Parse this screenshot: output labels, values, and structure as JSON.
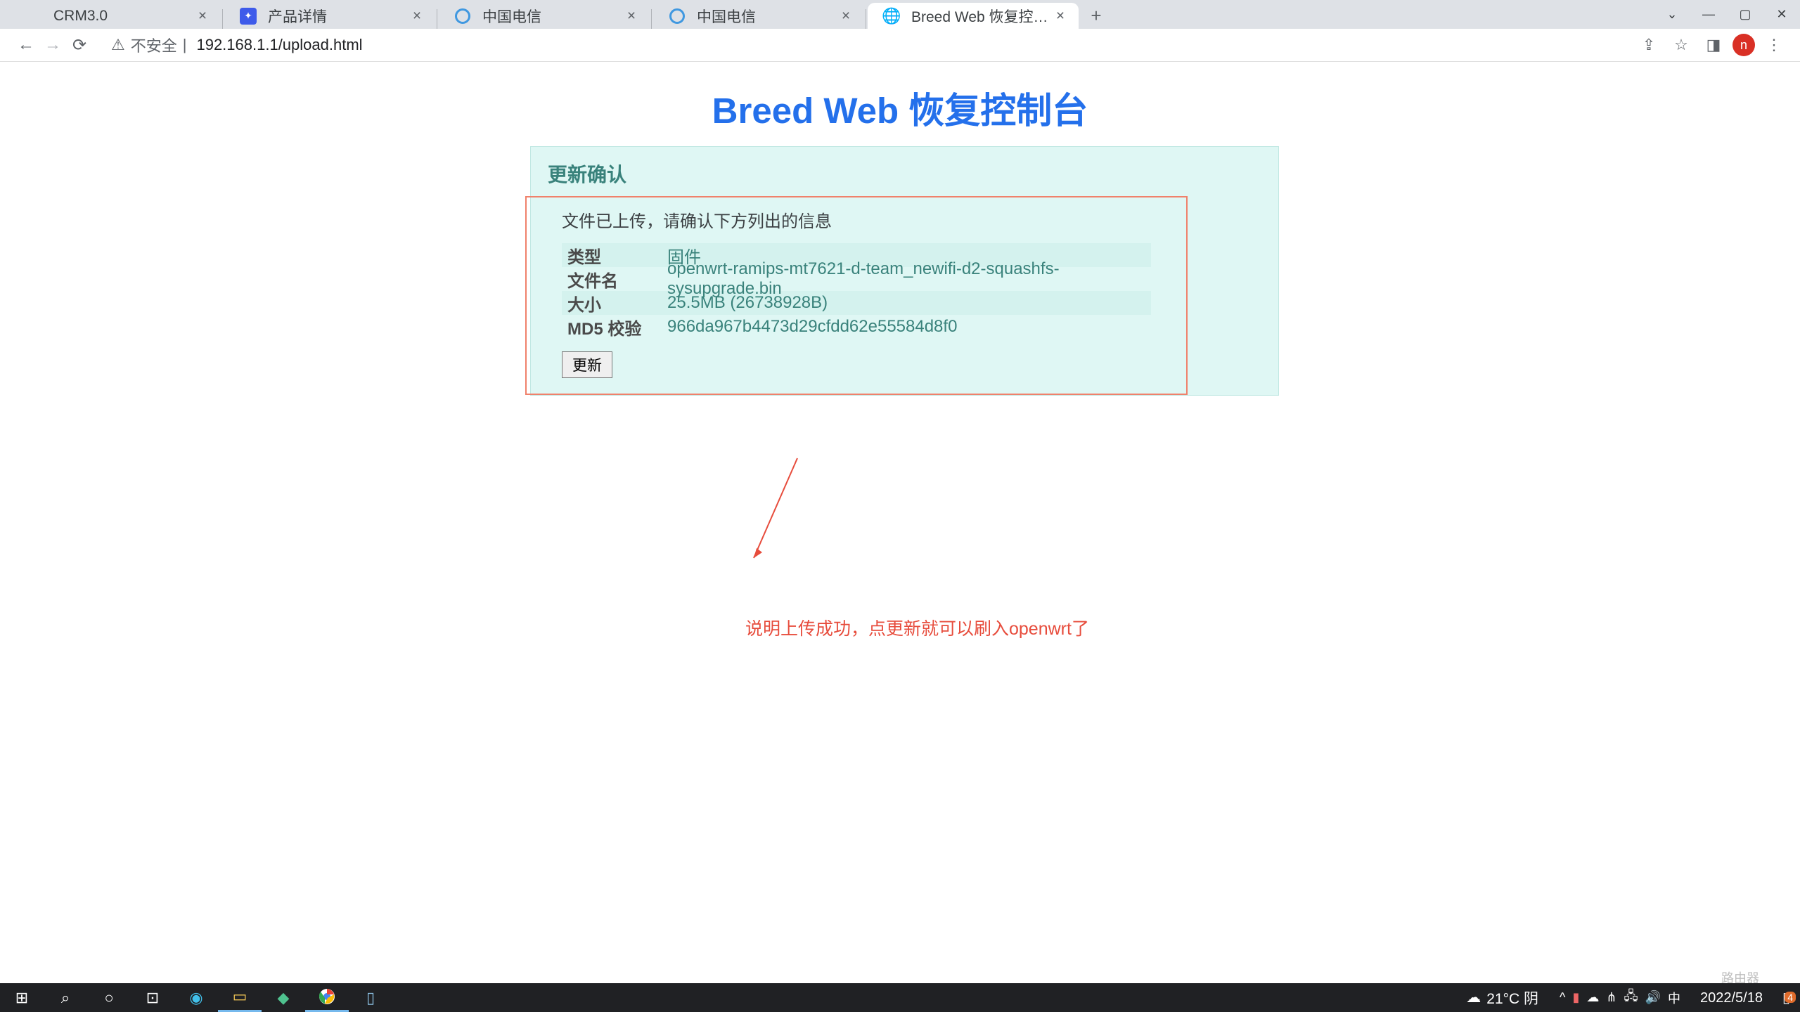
{
  "tabs": [
    {
      "title": "CRM3.0",
      "favicon_type": "blank"
    },
    {
      "title": "产品详情",
      "favicon_type": "blue"
    },
    {
      "title": "中国电信",
      "favicon_type": "circle"
    },
    {
      "title": "中国电信",
      "favicon_type": "circle"
    },
    {
      "title": "Breed Web 恢复控制台",
      "favicon_type": "globe",
      "active": true
    }
  ],
  "address": {
    "security_label": "不安全",
    "separator": "|",
    "url": "192.168.1.1/upload.html"
  },
  "profile_letter": "n",
  "page": {
    "title": "Breed Web 恢复控制台",
    "panel_header": "更新确认",
    "upload_message": "文件已上传，请确认下方列出的信息",
    "rows": [
      {
        "label": "类型",
        "value": "固件"
      },
      {
        "label": "文件名",
        "value": "openwrt-ramips-mt7621-d-team_newifi-d2-squashfs-sysupgrade.bin"
      },
      {
        "label": "大小",
        "value": "25.5MB (26738928B)"
      },
      {
        "label": "MD5 校验",
        "value": "966da967b4473d29cfdd62e55584d8f0"
      }
    ],
    "update_button": "更新",
    "annotation": "说明上传成功，点更新就可以刷入openwrt了"
  },
  "watermark": "路由器",
  "taskbar": {
    "weather": "21°C 阴",
    "ime": "中",
    "time": "2022/5/18",
    "notif_count": "4"
  }
}
